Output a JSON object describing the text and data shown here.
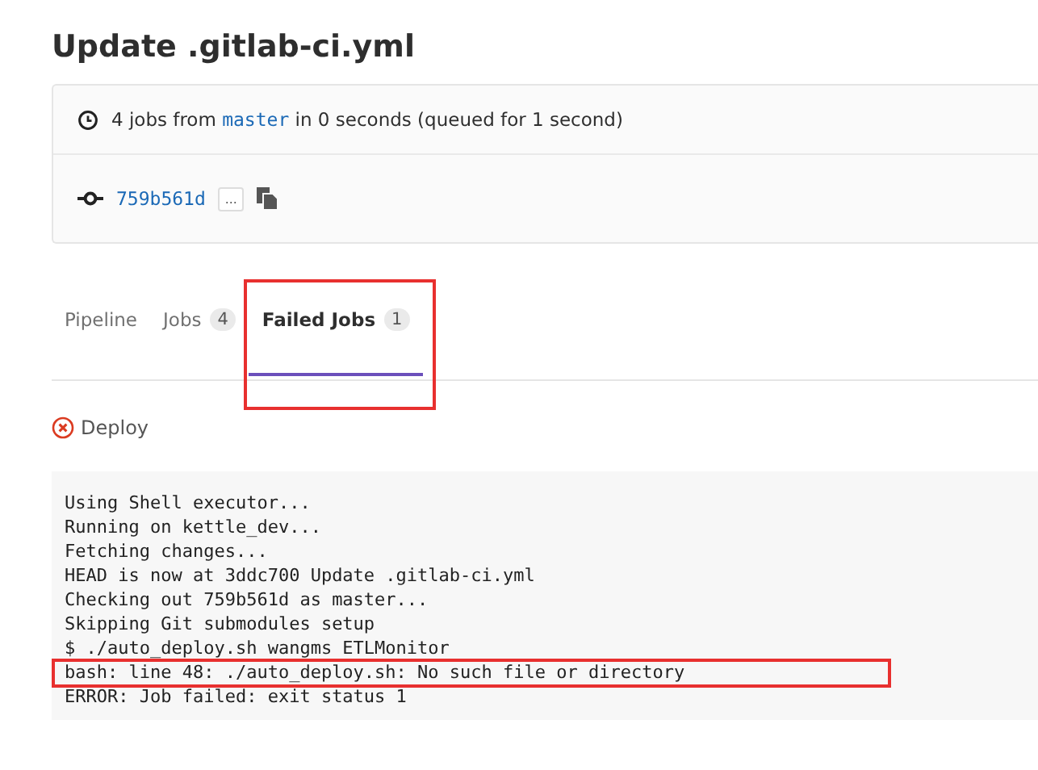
{
  "title": "Update .gitlab-ci.yml",
  "summary": {
    "count_text": "4 jobs from",
    "branch": "master",
    "rest": "in 0 seconds (queued for 1 second)"
  },
  "commit": {
    "sha": "759b561d",
    "ellipsis": "..."
  },
  "tabs": [
    {
      "label": "Pipeline",
      "selected": false,
      "highlighted": false
    },
    {
      "label": "Jobs",
      "count": "4",
      "selected": false,
      "highlighted": false
    },
    {
      "label": "Failed Jobs",
      "count": "1",
      "selected": true,
      "highlighted": true
    }
  ],
  "failed_job": {
    "name": "Deploy"
  },
  "log": [
    {
      "text": "Using Shell executor...",
      "highlighted": false
    },
    {
      "text": "Running on kettle_dev...",
      "highlighted": false
    },
    {
      "text": "Fetching changes...",
      "highlighted": false
    },
    {
      "text": "HEAD is now at 3ddc700 Update .gitlab-ci.yml",
      "highlighted": false
    },
    {
      "text": "Checking out 759b561d as master...",
      "highlighted": false
    },
    {
      "text": "Skipping Git submodules setup",
      "highlighted": false
    },
    {
      "text": "$ ./auto_deploy.sh wangms ETLMonitor",
      "highlighted": false
    },
    {
      "text": "bash: line 48: ./auto_deploy.sh: No such file or directory",
      "highlighted": true
    },
    {
      "text": "ERROR: Job failed: exit status 1",
      "highlighted": false
    }
  ]
}
